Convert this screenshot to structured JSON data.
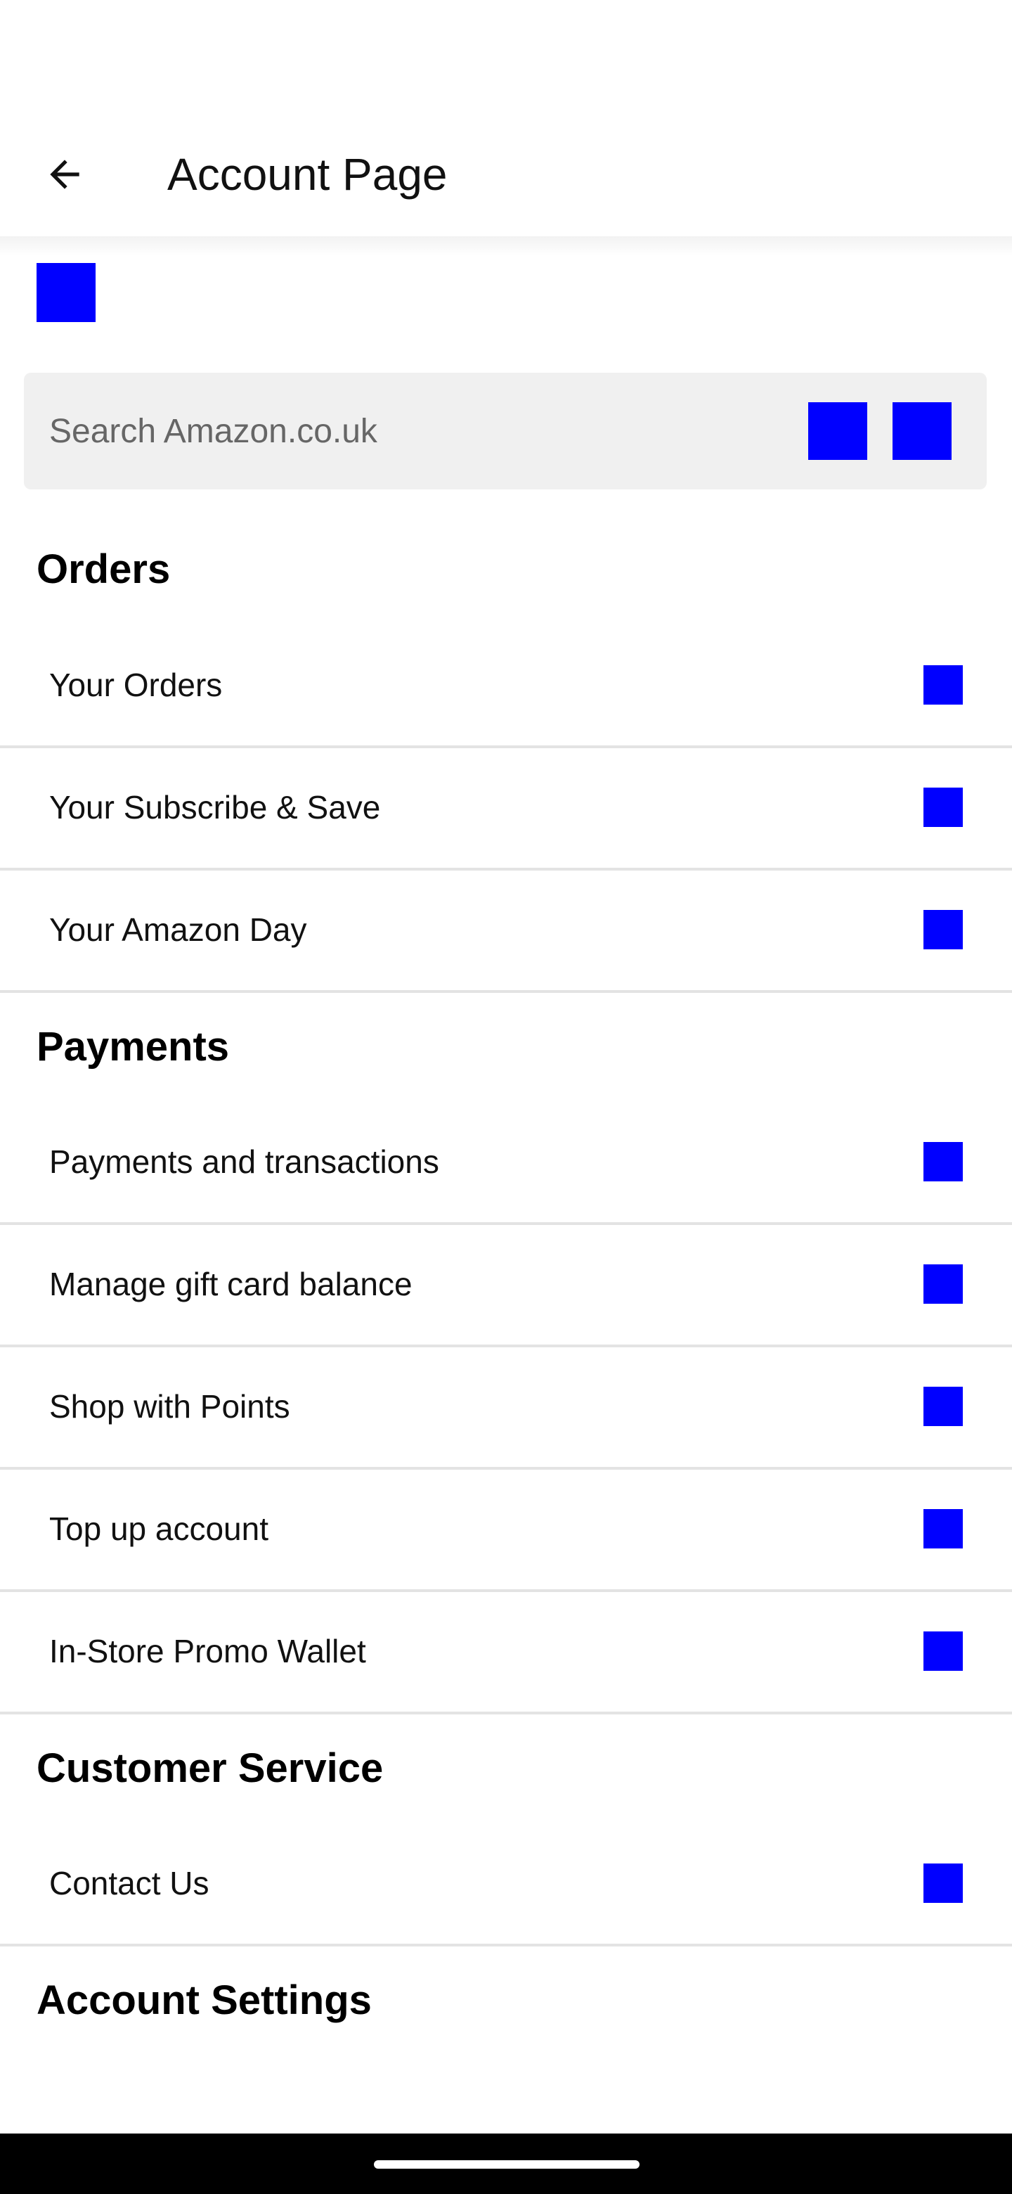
{
  "app_bar": {
    "title": "Account Page"
  },
  "search": {
    "placeholder": "Search Amazon.co.uk"
  },
  "sections": [
    {
      "title": "Orders",
      "items": [
        "Your Orders",
        "Your Subscribe & Save",
        "Your Amazon Day"
      ]
    },
    {
      "title": "Payments",
      "items": [
        "Payments and transactions",
        "Manage gift card balance",
        "Shop with Points",
        "Top up account",
        "In-Store Promo Wallet"
      ]
    },
    {
      "title": "Customer Service",
      "items": [
        "Contact Us"
      ]
    },
    {
      "title": "Account Settings",
      "items": []
    }
  ],
  "icons": {
    "back": "arrow-left-icon",
    "logo": "amazon-logo-icon",
    "camera": "camera-icon",
    "mic": "microphone-icon",
    "chevron": "chevron-right-icon"
  },
  "colors": {
    "icon_placeholder": "#0000ff",
    "search_bg": "#f0f0f0",
    "divider": "#e3e3e3"
  }
}
